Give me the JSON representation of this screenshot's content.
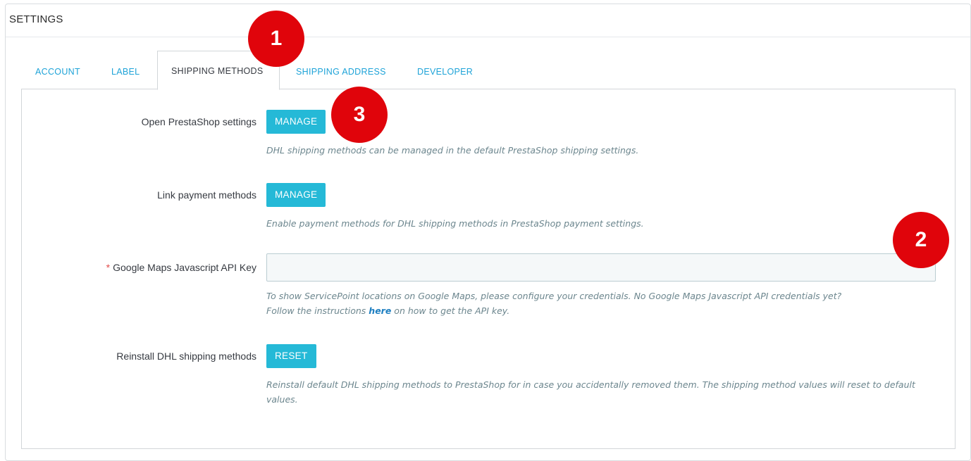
{
  "panel": {
    "heading": "SETTINGS"
  },
  "tabs": [
    {
      "label": "ACCOUNT",
      "active": false
    },
    {
      "label": "LABEL",
      "active": false
    },
    {
      "label": "SHIPPING METHODS",
      "active": true
    },
    {
      "label": "SHIPPING ADDRESS",
      "active": false
    },
    {
      "label": "DEVELOPER",
      "active": false
    }
  ],
  "rows": {
    "prestashop": {
      "label": "Open PrestaShop settings",
      "button": "MANAGE",
      "help": "DHL shipping methods can be managed in the default PrestaShop shipping settings."
    },
    "payment": {
      "label": "Link payment methods",
      "button": "MANAGE",
      "help": "Enable payment methods for DHL shipping methods in PrestaShop payment settings."
    },
    "maps": {
      "required_mark": "*",
      "label": "Google Maps Javascript API Key",
      "value": "",
      "help_line1": "To show ServicePoint locations on Google Maps, please configure your credentials. No Google Maps Javascript API credentials yet?",
      "help_line2_before": "Follow the instructions ",
      "help_link": "here",
      "help_line2_after": " on how to get the API key."
    },
    "reinstall": {
      "label": "Reinstall DHL shipping methods",
      "button": "RESET",
      "help": "Reinstall default DHL shipping methods to PrestaShop for in case you accidentally removed them. The shipping method values will reset to default values."
    }
  },
  "markers": [
    "1",
    "2",
    "3"
  ],
  "colors": {
    "accent": "#25b9d7",
    "marker": "#e0040b",
    "link": "#1e7fc1",
    "required": "#e24c4b"
  }
}
